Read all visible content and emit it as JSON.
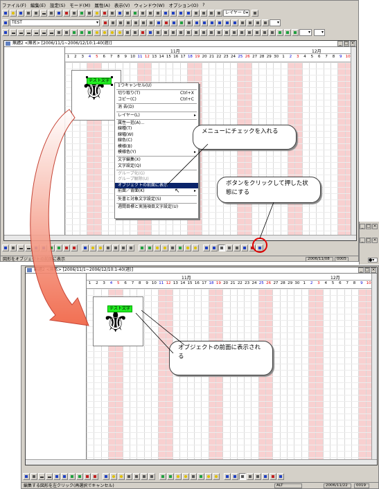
{
  "menu": [
    "ファイル(F)",
    "編集(E)",
    "設定(S)",
    "モード(M)",
    "属性(A)",
    "表示(V)",
    "ウィンドウ(W)",
    "オプション(O)",
    "?"
  ],
  "toolbar": {
    "combo_text": "TEST",
    "layer_combo": "レイヤー 0"
  },
  "window1": {
    "title": "無題2 <無名> [2006/11/1~2006/12/10:1-40(週)]",
    "label_period": "期間",
    "label_task": "作業",
    "month_nov": "11月",
    "month_dec": "12月",
    "days": [
      "1",
      "2",
      "3",
      "4",
      "5",
      "6",
      "7",
      "8",
      "9",
      "10",
      "11",
      "12",
      "13",
      "14",
      "15",
      "16",
      "17",
      "18",
      "19",
      "20",
      "21",
      "22",
      "23",
      "24",
      "25",
      "26",
      "27",
      "28",
      "29",
      "30",
      "1",
      "2",
      "3",
      "4",
      "5",
      "6",
      "7",
      "8",
      "9",
      "10"
    ],
    "green_text": "テスト文字",
    "status_text": "図形をオブジェクトの前面に表示",
    "status_date": "2006/11/08",
    "status_code": "0005"
  },
  "context_menu": [
    {
      "label": "1つキャンセル(U)",
      "type": "item"
    },
    {
      "type": "sep"
    },
    {
      "label": "切り取り(T)",
      "shortcut": "Ctrl+X",
      "type": "item"
    },
    {
      "label": "コピー(C)",
      "shortcut": "Ctrl+C",
      "type": "item"
    },
    {
      "type": "sep"
    },
    {
      "label": "消 去(D)",
      "type": "item"
    },
    {
      "type": "sep"
    },
    {
      "label": "レイヤー(L)",
      "type": "item",
      "sub": true
    },
    {
      "type": "sep"
    },
    {
      "label": "属性一括(A)...",
      "type": "item"
    },
    {
      "label": "線種(T)",
      "type": "item"
    },
    {
      "label": "線幅(W)",
      "type": "item"
    },
    {
      "label": "線色(C)",
      "type": "item"
    },
    {
      "label": "模様(B)",
      "type": "item"
    },
    {
      "label": "模様色(Y)",
      "type": "item",
      "sub": true
    },
    {
      "type": "sep"
    },
    {
      "label": "文字編集(X)",
      "type": "item"
    },
    {
      "label": "文字設定(Q)",
      "type": "item"
    },
    {
      "type": "sep"
    },
    {
      "label": "グループ化(G)",
      "type": "item",
      "disabled": true
    },
    {
      "label": "グループ解除(U)",
      "type": "item",
      "disabled": true
    },
    {
      "label": "オブジェクトの前面に表示",
      "type": "item",
      "highlight": true
    },
    {
      "label": "前面／背面(K)",
      "type": "item",
      "sub": true
    },
    {
      "type": "sep"
    },
    {
      "label": "矢書と対象文字設定(S)",
      "type": "item"
    },
    {
      "type": "sep"
    },
    {
      "label": "週間目標と実施項目文字設定(U)",
      "type": "item"
    }
  ],
  "callouts": {
    "check_menu": "メニューにチェックを入れる",
    "press_button": "ボタンをクリックして押した状態にする",
    "front_result": "オブジェクトの前面に表示される"
  },
  "window2": {
    "title": "無題2 <無名> [2006/11/1~2006/12/10:1-40(週)]",
    "label_period": "期間",
    "label_task": "作業",
    "month_nov": "11月",
    "month_dec": "12月",
    "green_text": "テスト文字",
    "status_text": "編集する図形を左クリック(再選択でキャンセル)",
    "status_alt": "ALT",
    "status_date": "2006/11/22",
    "status_code": "0019"
  },
  "colors": {
    "highlight": "#0a246a",
    "weekend_red": "#e00000",
    "weekend_blue": "#0000d0",
    "stripe": "#f8d0d0",
    "green": "#22ee22",
    "red_circle": "#e00000"
  }
}
